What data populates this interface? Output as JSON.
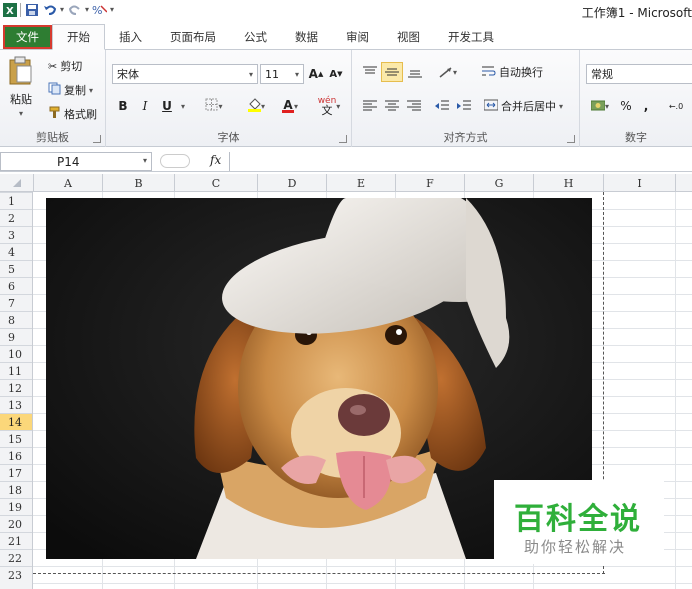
{
  "window": {
    "title": "工作簿1 - Microsoft"
  },
  "tabs": [
    {
      "label": "文件"
    },
    {
      "label": "开始"
    },
    {
      "label": "插入"
    },
    {
      "label": "页面布局"
    },
    {
      "label": "公式"
    },
    {
      "label": "数据"
    },
    {
      "label": "审阅"
    },
    {
      "label": "视图"
    },
    {
      "label": "开发工具"
    }
  ],
  "ribbon": {
    "clipboard": {
      "paste": "粘贴",
      "cut": "剪切",
      "copy": "复制",
      "format_painter": "格式刷",
      "label": "剪贴板"
    },
    "font": {
      "name": "宋体",
      "size": "11",
      "bold": "B",
      "italic": "I",
      "underline": "U",
      "label": "字体",
      "grow": "A",
      "shrink": "A",
      "font_color": "A",
      "phonetic": "wén"
    },
    "alignment": {
      "wrap": "自动换行",
      "merge": "合并后居中",
      "label": "对齐方式"
    },
    "number": {
      "format": "常规",
      "percent": "%",
      "comma": ",",
      "label": "数字"
    }
  },
  "formula_bar": {
    "name_box": "P14",
    "fx": "fx",
    "value": ""
  },
  "sheet": {
    "columns": [
      "A",
      "B",
      "C",
      "D",
      "E",
      "F",
      "G",
      "H",
      "I"
    ],
    "rows": [
      "1",
      "2",
      "3",
      "4",
      "5",
      "6",
      "7",
      "8",
      "9",
      "10",
      "11",
      "12",
      "13",
      "14",
      "15",
      "16",
      "17",
      "18",
      "19",
      "20",
      "21",
      "22",
      "23"
    ],
    "selected_row": "14"
  },
  "watermark": {
    "title": "百科全说",
    "subtitle": "助你轻松解决"
  },
  "colors": {
    "file_tab": "#2e7d32",
    "selected_row": "#fbd77a",
    "watermark": "#2faf3a"
  }
}
